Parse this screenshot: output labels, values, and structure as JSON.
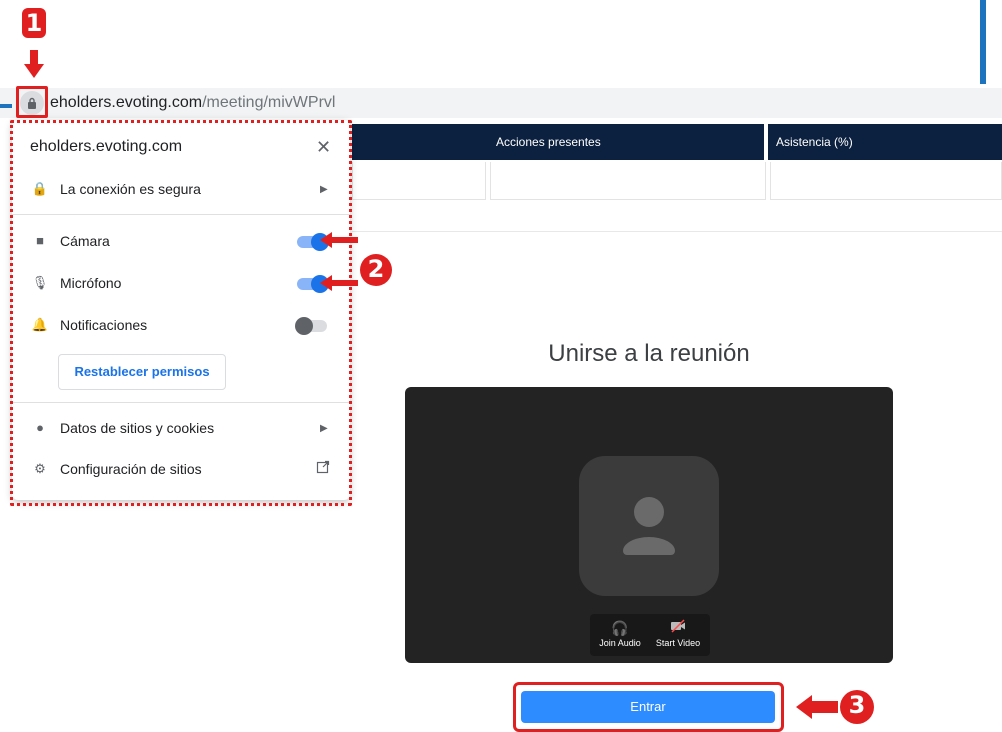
{
  "browser": {
    "url_host": "eholders.evoting.com",
    "url_path": "/meeting/mivWPrvl"
  },
  "table": {
    "columns": [
      "",
      "Acciones presentes",
      "Asistencia (%)"
    ]
  },
  "site_popup": {
    "title": "eholders.evoting.com",
    "close_glyph": "✕",
    "connection_label": "La conexión es segura",
    "camera_label": "Cámara",
    "camera_enabled": true,
    "microphone_label": "Micrófono",
    "microphone_enabled": true,
    "notifications_label": "Notificaciones",
    "notifications_enabled": false,
    "reset_button_label": "Restablecer permisos",
    "cookies_label": "Datos de sitios y cookies",
    "site_settings_label": "Configuración de sitios"
  },
  "meeting": {
    "title": "Unirse a la reunión",
    "join_audio_label": "Join Audio",
    "start_video_label": "Start Video",
    "enter_button_label": "Entrar"
  },
  "annotations": {
    "badge1": "1",
    "badge2": "2",
    "badge3": "3",
    "color": "#e02020"
  },
  "colors": {
    "table_header": "#0c2140",
    "zoom_blue": "#2d8cff",
    "toggle_on": "#1a73e8"
  }
}
